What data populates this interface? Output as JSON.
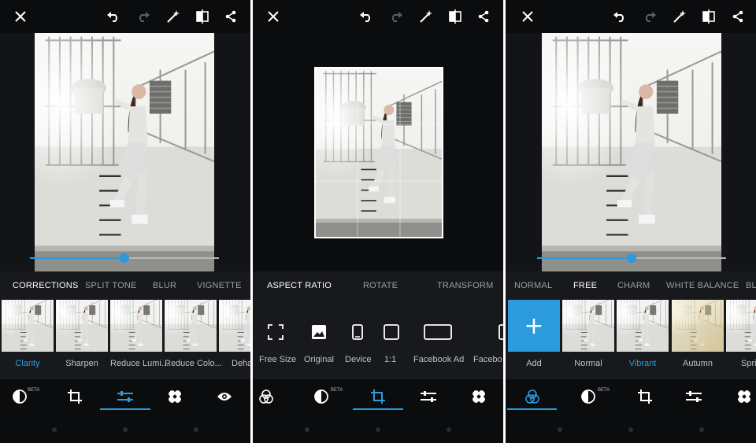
{
  "colors": {
    "accent": "#2b9bde",
    "background": "#0b0c0e",
    "panel": "#17191c"
  },
  "screens": [
    {
      "tabs": [
        "CORRECTIONS",
        "SPLIT TONE",
        "BLUR",
        "VIGNETTE"
      ],
      "active_tab": "CORRECTIONS",
      "slider_value": 0.5,
      "thumbnails": [
        "Clarity",
        "Sharpen",
        "Reduce Lumi...",
        "Reduce Colo...",
        "Deha"
      ],
      "active_thumbnail": "Clarity",
      "bottom_tools": [
        "looks-icon",
        "crop-icon",
        "adjustments-icon",
        "healing-icon",
        "eye-icon"
      ],
      "active_bottom_tool": "adjustments-icon",
      "beta_label": "BETA"
    },
    {
      "tabs": [
        "ASPECT RATIO",
        "ROTATE",
        "TRANSFORM"
      ],
      "active_tab": "ASPECT RATIO",
      "aspect_options": [
        "Free Size",
        "Original",
        "Device",
        "1:1",
        "Facebook Ad",
        "Facebo"
      ],
      "bottom_tools": [
        "themes-icon",
        "looks-icon",
        "crop-icon",
        "adjustments-icon",
        "healing-icon"
      ],
      "active_bottom_tool": "crop-icon",
      "beta_label": "BETA"
    },
    {
      "tabs": [
        "NORMAL",
        "FREE",
        "CHARM",
        "WHITE BALANCE",
        "BL"
      ],
      "active_tab": "FREE",
      "slider_value": 0.5,
      "add_label": "Add",
      "add_symbol": "+",
      "thumbnails": [
        "Normal",
        "Vibrant",
        "Autumn",
        "Spri"
      ],
      "active_thumbnail": "Vibrant",
      "bottom_tools": [
        "themes-icon",
        "looks-icon",
        "crop-icon",
        "adjustments-icon",
        "healing-icon"
      ],
      "active_bottom_tool": "themes-icon",
      "beta_label": "BETA"
    }
  ],
  "top_icons": [
    "close-icon",
    "undo-icon",
    "redo-icon",
    "auto-fix-icon",
    "compare-icon",
    "share-icon"
  ]
}
